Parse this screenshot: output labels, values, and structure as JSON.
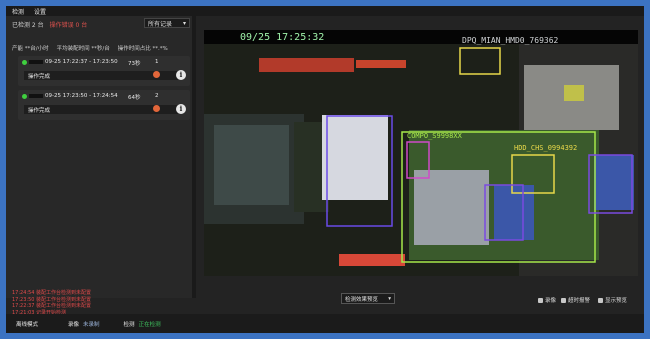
{
  "menu": [
    "检测",
    "设置"
  ],
  "stats": {
    "detected_label": "已检测 2 台",
    "error_label": "操作错误 0 台",
    "filter_value": "所有记录",
    "filter_arrow": "▾"
  },
  "summary": [
    "产能 **台/小时",
    "平均装配时间 **秒/台",
    "操作时间占比 **.*%"
  ],
  "records": [
    {
      "time_range": "09-25 17:22:37 - 17:23:50",
      "duration": "73秒",
      "count": "1",
      "status": "操作完成",
      "info_icon": "i"
    },
    {
      "time_range": "09-25 17:23:50 - 17:24:54",
      "duration": "64秒",
      "count": "2",
      "status": "操作完成",
      "info_icon": "i"
    }
  ],
  "log_lines": [
    "17:24:54  装配工作台检测到未配置",
    "17:23:50  装配工作台检测到未配置",
    "17:22:37  装配工作台检测到未配置",
    "17:21:03  记录开始检测"
  ],
  "video": {
    "timestamp": "09/25 17:25:32",
    "overlay_code_1": "DPQ_MIAN_HMD0_769362",
    "overlay_code_2": "COMPO_S9998XX",
    "overlay_code_3": "HDD_CHS_0994392"
  },
  "controls": {
    "select_value": "检测效果预览",
    "select_arrow": "▾",
    "checkboxes": [
      "录像",
      "超时报警",
      "显示预览"
    ]
  },
  "statusbar": {
    "mode_label": "离线模式",
    "record_label": "录像",
    "record_value": "未录制",
    "detect_label": "检测",
    "detect_value": "正在检测"
  },
  "colors": {
    "background": "#3c73c2",
    "box_purple": "#7b4ae0",
    "box_green": "#9ee84a",
    "box_yellow": "#e8d84a",
    "box_pink": "#d04ac8",
    "status_ok": "#3fc25f",
    "error": "#e0524e"
  }
}
